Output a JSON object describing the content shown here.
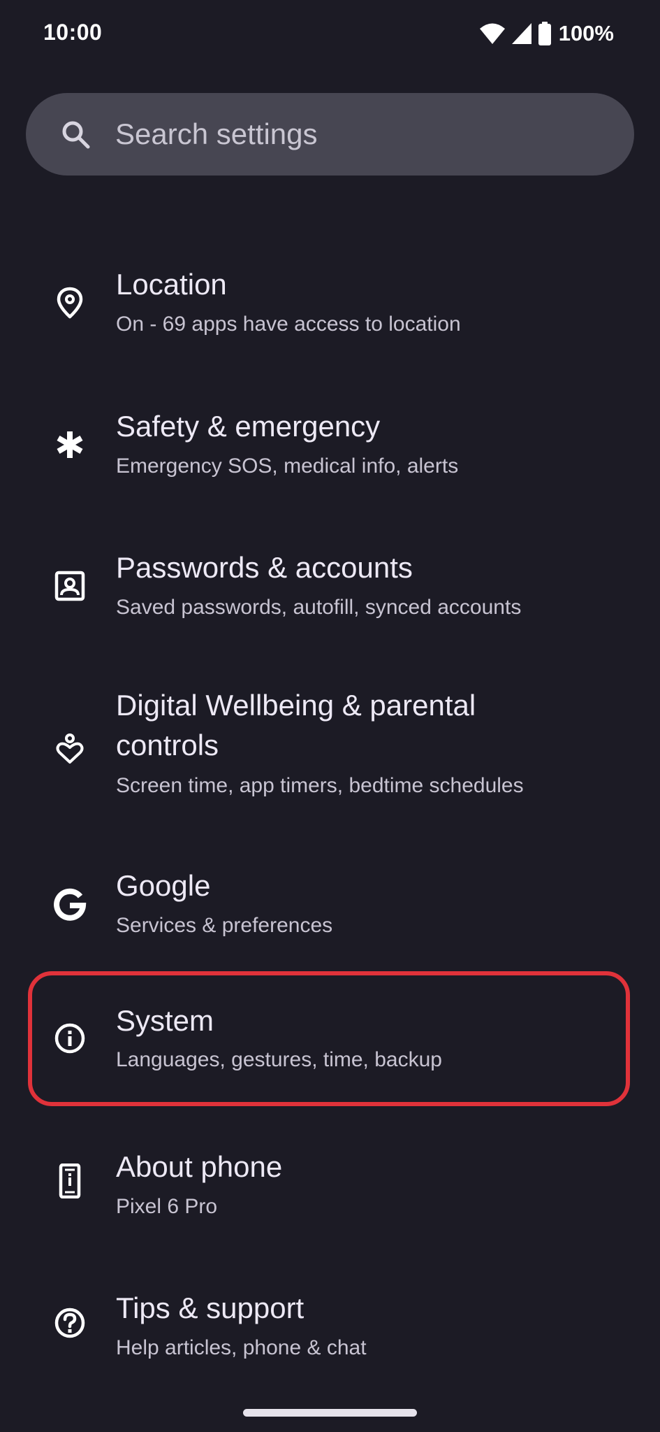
{
  "status_bar": {
    "time": "10:00",
    "battery": "100%",
    "icons": [
      "wifi-icon",
      "cell-signal-icon",
      "battery-icon"
    ]
  },
  "search": {
    "placeholder": "Search settings",
    "icon": "search-icon"
  },
  "items": [
    {
      "title": "Location",
      "subtitle": "On - 69 apps have access to location",
      "icon": "location-pin-icon"
    },
    {
      "title": "Safety & emergency",
      "subtitle": "Emergency SOS, medical info, alerts",
      "icon": "asterisk-icon"
    },
    {
      "title": "Passwords & accounts",
      "subtitle": "Saved passwords, autofill, synced accounts",
      "icon": "account-box-icon"
    },
    {
      "title_line1": "Digital Wellbeing & parental",
      "title_line2": "controls",
      "subtitle": "Screen time, app timers, bedtime schedules",
      "icon": "wellbeing-icon"
    },
    {
      "title": "Google",
      "subtitle": "Services & preferences",
      "icon": "google-g-icon"
    },
    {
      "title": "System",
      "subtitle": "Languages, gestures, time, backup",
      "icon": "info-icon",
      "highlighted": true
    },
    {
      "title": "About phone",
      "subtitle": "Pixel 6 Pro",
      "icon": "phone-icon"
    },
    {
      "title": "Tips & support",
      "subtitle": "Help articles, phone & chat",
      "icon": "help-icon"
    }
  ],
  "colors": {
    "background": "#1c1b25",
    "search_bar": "#474652",
    "highlight_border": "#e0323a"
  }
}
